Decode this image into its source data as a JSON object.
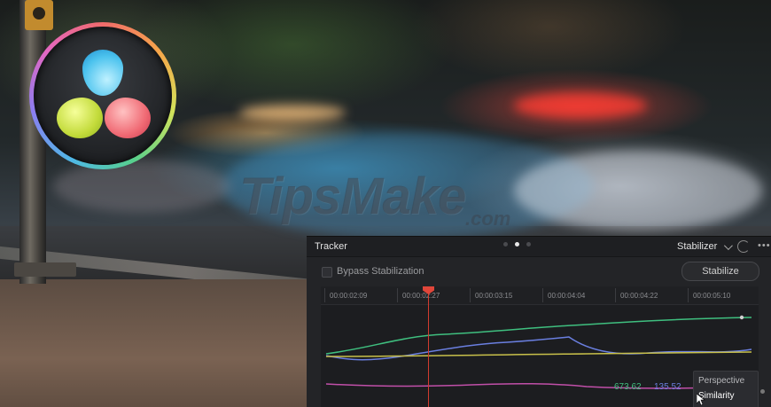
{
  "watermark": {
    "brand": "TipsMake",
    "suffix": ".com"
  },
  "tracker": {
    "title": "Tracker",
    "mode": "Stabilizer",
    "bypass_label": "Bypass Stabilization",
    "stabilize_label": "Stabilize",
    "timecodes": [
      "00:00:02:09",
      "00:00:02:27",
      "00:00:03:15",
      "00:00:04:04",
      "00:00:04:22",
      "00:00:05:10"
    ],
    "graph_values": {
      "green": "673.62",
      "purple": "135.52"
    },
    "menu": {
      "items": [
        "Perspective",
        "Similarity"
      ],
      "selected": "Similarity"
    },
    "curve_colors": {
      "green": "#3fbf7f",
      "blue": "#6a7fe0",
      "yellow": "#c8c04a",
      "magenta": "#c04fa8",
      "playhead": "#d23b2f"
    }
  }
}
